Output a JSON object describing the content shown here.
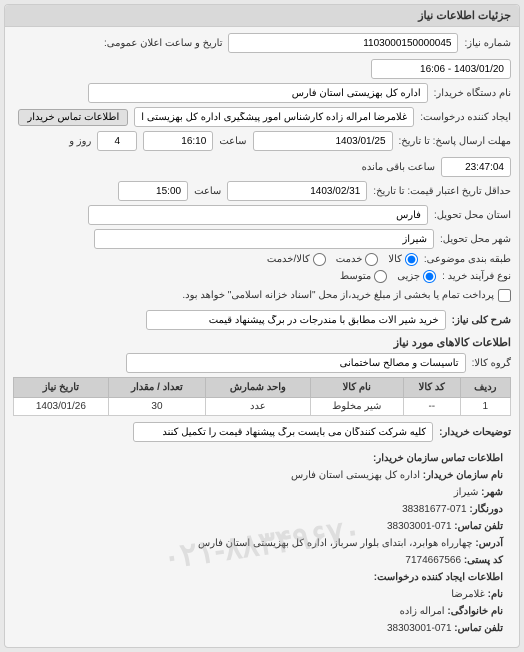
{
  "panel_title": "جزئیات اطلاعات نیاز",
  "fields": {
    "need_number_label": "شماره نیاز:",
    "need_number": "1103000150000045",
    "announce_label": "تاریخ و ساعت اعلان عمومی:",
    "announce_value": "1403/01/20 - 16:06",
    "org_label": "نام دستگاه خریدار:",
    "org_value": "اداره کل بهزیستی استان فارس",
    "creator_label": "ایجاد کننده درخواست:",
    "creator_value": "غلامرضا امراله زاده کارشناس امور پیشگیری اداره کل بهزیستی استان فارس",
    "contact_btn": "اطلاعات تماس خریدار",
    "deadline_label": "مهلت ارسال پاسخ: تا تاریخ:",
    "deadline_date": "1403/01/25",
    "deadline_time_label": "ساعت",
    "deadline_time": "16:10",
    "remain_day_label": "روز و",
    "remain_day": "4",
    "remain_time": "23:47:04",
    "remain_suffix": "ساعت باقی مانده",
    "validity_label": "حداقل تاریخ اعتبار قیمت: تا تاریخ:",
    "validity_date": "1403/02/31",
    "validity_time": "15:00",
    "province_label": "استان محل تحویل:",
    "province": "فارس",
    "city_label": "شهر محل تحویل:",
    "city": "شیراز",
    "subject_type_label": "طبقه بندی موضوعی:",
    "radio_kala": "کالا",
    "radio_khadamat": "خدمت",
    "radio_kala_khadamat": "کالا/خدمت",
    "buy_type_label": "نوع فرآیند خرید :",
    "radio_jozi": "جزیی",
    "radio_motavaset": "متوسط",
    "checkbox_payment": "پرداخت تمام یا بخشی از مبلغ خرید،از محل \"اسناد خزانه اسلامی\" خواهد بود.",
    "desc_label": "شرح کلی نیاز:",
    "desc_value": "خرید شیر آلات مطابق با مندرجات در برگ پیشنهاد قیمت"
  },
  "goods": {
    "title": "اطلاعات کالاهای مورد نیاز",
    "group_label": "گروه کالا:",
    "group_value": "تاسیسات و مصالح ساختمانی",
    "headers": [
      "ردیف",
      "کد کالا",
      "نام کالا",
      "واحد شمارش",
      "تعداد / مقدار",
      "تاریخ نیاز"
    ],
    "row": {
      "idx": "1",
      "code": "--",
      "name": "شیر مخلوط",
      "unit": "عدد",
      "qty": "30",
      "date": "1403/01/26"
    },
    "note_label": "توضیحات خریدار:",
    "note_value": "کلیه شرکت کنندگان می بایست برگ پیشنهاد قیمت را تکمیل کنند"
  },
  "contact": {
    "title": "اطلاعات تماس سازمان خریدار:",
    "org_label": "نام سازمان خریدار:",
    "org": "اداره کل بهزیستی استان فارس",
    "city_label": "شهر:",
    "city": "شیراز",
    "fax_label": "دورنگار:",
    "fax": "071-38381677",
    "tel_label": "تلفن تماس:",
    "tel": "071-38303001",
    "addr_label": "آدرس:",
    "addr": "چهارراه هوابرد، ابتدای بلوار سرباز، اداره کل بهزیستی استان فارس",
    "postal_label": "کد پستی:",
    "postal": "7174667566",
    "req_title": "اطلاعات ایجاد کننده درخواست:",
    "name_label": "نام:",
    "name": "غلامرضا",
    "lname_label": "نام خانوادگی:",
    "lname": "امراله زاده",
    "rtel_label": "تلفن تماس:",
    "rtel": "071-38303001",
    "watermark": "۰۲۱-۸۸۳۴۹۶۷۰"
  }
}
